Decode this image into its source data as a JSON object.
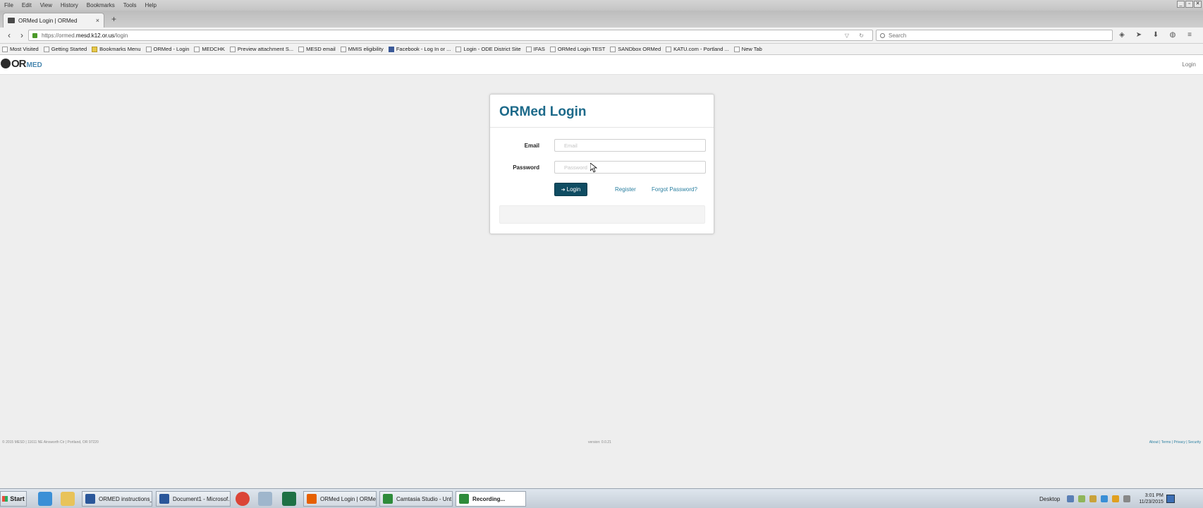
{
  "menubar": {
    "items": [
      "File",
      "Edit",
      "View",
      "History",
      "Bookmarks",
      "Tools",
      "Help"
    ]
  },
  "window_controls": [
    "_",
    "▫",
    "✕"
  ],
  "tab": {
    "title": "ORMed Login | ORMed",
    "close": "×",
    "new_tab": "+"
  },
  "navbar": {
    "back": "‹",
    "forward": "›",
    "url_prefix": "https://ormed.",
    "url_domain": "mesd.k12.or.us",
    "url_path": "/login",
    "url_tools": "▽ ↻",
    "search_placeholder": "Search"
  },
  "bookmarks": [
    {
      "label": "Most Visited",
      "icon": "bookmark-star-icon"
    },
    {
      "label": "Getting Started",
      "icon": "page-icon"
    },
    {
      "label": "Bookmarks Menu",
      "icon": "folder-icon"
    },
    {
      "label": "ORMed - Login",
      "icon": "ormed-icon"
    },
    {
      "label": "MEDCHK",
      "icon": "page-icon"
    },
    {
      "label": "Preview attachment S...",
      "icon": "page-icon"
    },
    {
      "label": "MESD email",
      "icon": "mail-icon"
    },
    {
      "label": "MMIS eligibility",
      "icon": "page-icon"
    },
    {
      "label": "Facebook - Log In or ...",
      "icon": "facebook-icon"
    },
    {
      "label": "Login - ODE District Site",
      "icon": "ode-icon"
    },
    {
      "label": "IFAS",
      "icon": "page-icon"
    },
    {
      "label": "ORMed Login TEST",
      "icon": "ormed-icon"
    },
    {
      "label": "SANDbox ORMed",
      "icon": "page-icon"
    },
    {
      "label": "KATU.com - Portland ...",
      "icon": "page-icon"
    },
    {
      "label": "New Tab",
      "icon": "page-icon"
    }
  ],
  "site": {
    "logo_or": "OR",
    "logo_med": "MED",
    "header_login": "Login"
  },
  "login": {
    "title": "ORMed Login",
    "email_label": "Email",
    "email_placeholder": "Email",
    "password_label": "Password",
    "password_placeholder": "Password",
    "login_button": "Login",
    "register_link": "Register",
    "forgot_link": "Forgot Password?"
  },
  "footer": {
    "left": "© 2015 MESD | 11611 NE Ainsworth Cir | Portland, OR 97220",
    "version": "version: 0.0.21",
    "links": "About | Terms | Privacy | Security"
  },
  "taskbar": {
    "start_label": "Start",
    "tasks": [
      {
        "label": "ORMED instructions_...",
        "color": "#2b579a",
        "active": false
      },
      {
        "label": "Document1 - Microsof...",
        "color": "#2b579a",
        "active": false
      },
      {
        "label": "ORMed Login | ORMe...",
        "color": "#e66000",
        "active": false
      },
      {
        "label": "Camtasia Studio - Unt...",
        "color": "#2e8b3a",
        "active": false
      },
      {
        "label": "Recording...",
        "color": "#2e8b3a",
        "active": true
      }
    ],
    "desktop_label": "Desktop",
    "time": "3:01 PM",
    "date": "11/23/2015"
  },
  "colors": {
    "accent": "#1d6a8a",
    "button": "#0f4c62",
    "link": "#2a7fa0",
    "page_bg": "#eeeeee"
  }
}
